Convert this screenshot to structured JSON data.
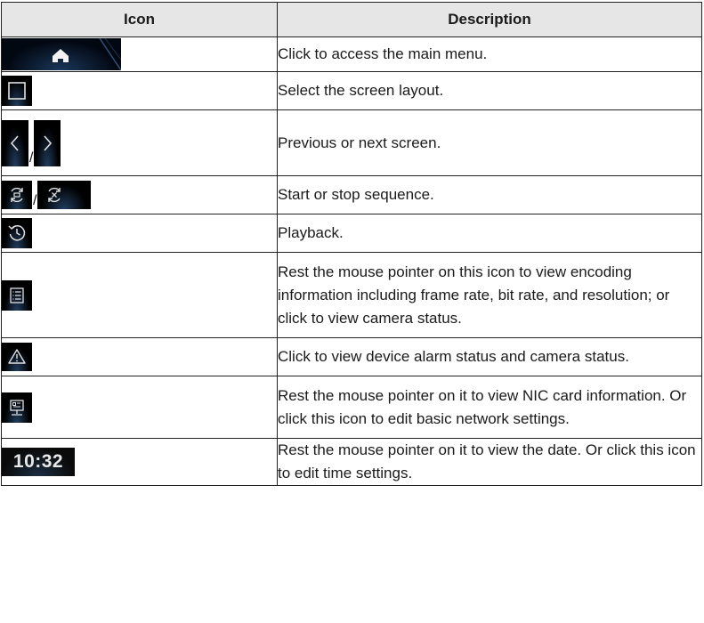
{
  "table": {
    "headers": {
      "icon": "Icon",
      "description": "Description"
    },
    "rows": [
      {
        "icon": "home-icon",
        "description": "Click to access the main menu."
      },
      {
        "icon": "screen-layout-icon",
        "description": "Select the screen layout."
      },
      {
        "icon": "previous-next-screen-icons",
        "separator": "/",
        "description": "Previous or next screen."
      },
      {
        "icon": "start-stop-sequence-icons",
        "separator": "/",
        "description": "Start or stop sequence."
      },
      {
        "icon": "playback-icon",
        "description": "Playback."
      },
      {
        "icon": "encoding-info-icon",
        "description": "Rest the mouse pointer on this icon to view encoding information including frame rate, bit rate, and resolution; or click to view camera status."
      },
      {
        "icon": "alarm-warning-icon",
        "description": "Click to view device alarm status and camera status."
      },
      {
        "icon": "network-icon",
        "description": "Rest the mouse pointer on it to view NIC card information. Or click this icon to edit basic network settings."
      },
      {
        "icon": "clock-icon",
        "clock_text": "10:32",
        "description": "Rest the mouse pointer on it to view the date. Or click this icon to edit time settings."
      }
    ]
  }
}
